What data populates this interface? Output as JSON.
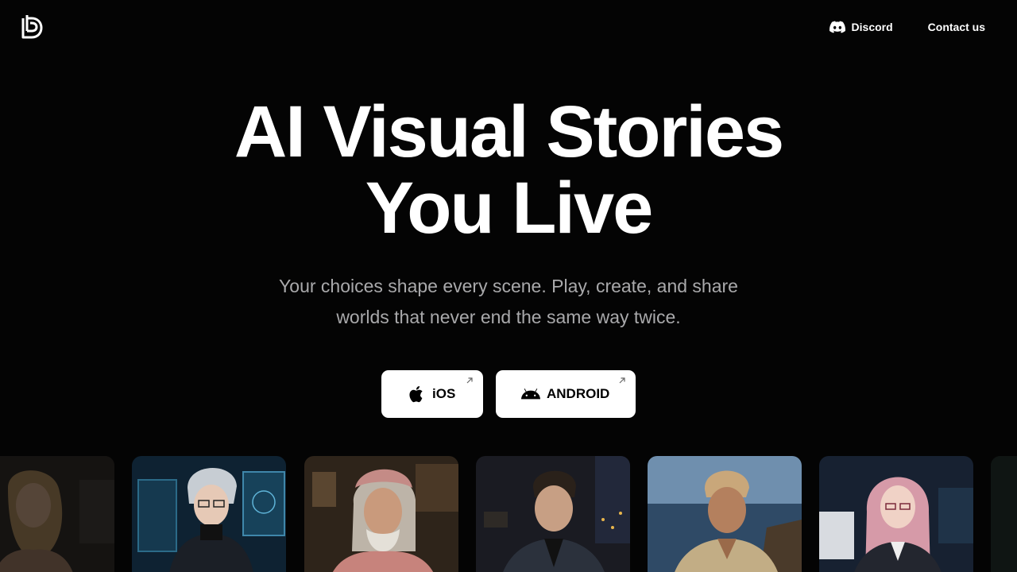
{
  "header": {
    "logo": "brand-logo",
    "nav": [
      {
        "label": "Discord",
        "icon": "discord-icon"
      },
      {
        "label": "Contact us"
      }
    ]
  },
  "hero": {
    "title_line1": "AI Visual Stories",
    "title_line2": "You Live",
    "subtitle_line1": "Your choices shape every scene. Play, create, and share",
    "subtitle_line2": "worlds that never end the same way twice."
  },
  "downloads": {
    "ios_label": "iOS",
    "ios_icon": "apple-icon",
    "android_label": "ANDROID",
    "android_icon": "android-icon",
    "external_icon": "arrow-up-right-icon"
  },
  "characters": [
    {
      "name": "card-woman-blonde",
      "bg": "#1c1c1c"
    },
    {
      "name": "card-anime-hacker",
      "bg": "#0d2433"
    },
    {
      "name": "card-old-man-hat",
      "bg": "#2b2017"
    },
    {
      "name": "card-man-jacket",
      "bg": "#161820"
    },
    {
      "name": "card-man-ocean",
      "bg": "#3b5876"
    },
    {
      "name": "card-anime-woman",
      "bg": "#151d29"
    }
  ],
  "colors": {
    "background": "#040404",
    "text": "#ffffff",
    "muted_text": "#a9a9ab",
    "button_bg": "#ffffff"
  }
}
